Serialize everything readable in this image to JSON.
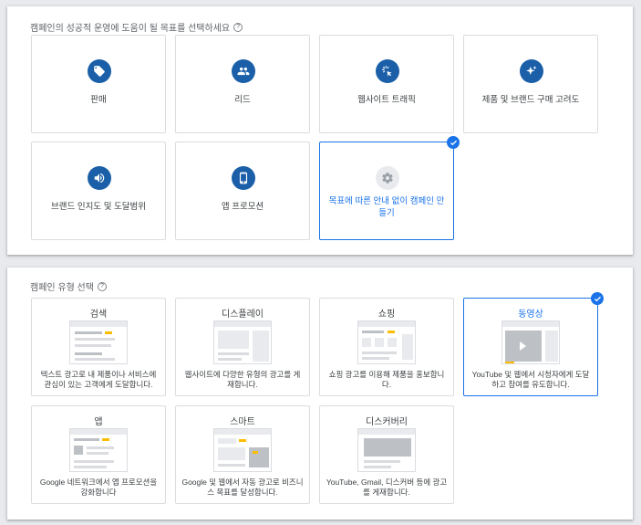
{
  "goal_section": {
    "title": "캠페인의 성공적 운영에 도움이 될 목표를 선택하세요",
    "help_icon": "question-circle-icon",
    "items": [
      {
        "label": "판매",
        "icon": "tag-icon"
      },
      {
        "label": "리드",
        "icon": "people-icon"
      },
      {
        "label": "웹사이트 트래픽",
        "icon": "cursor-click-icon"
      },
      {
        "label": "제품 및 브랜드 구매 고려도",
        "icon": "sparkle-icon"
      },
      {
        "label": "브랜드 인지도 및 도달범위",
        "icon": "speaker-icon"
      },
      {
        "label": "앱 프로모션",
        "icon": "phone-icon"
      },
      {
        "label": "목표에 따른 안내 없이 캠페인 만들기",
        "icon": "gear-icon",
        "selected": true
      }
    ]
  },
  "type_section": {
    "title": "캠페인 유형 선택",
    "help_icon": "question-circle-icon",
    "items": [
      {
        "label": "검색",
        "desc": "텍스트 광고로 내 제품이나 서비스에 관심이 있는 고객에게 도달합니다."
      },
      {
        "label": "디스플레이",
        "desc": "웹사이트에 다양한 유형의 광고를 게재합니다."
      },
      {
        "label": "쇼핑",
        "desc": "쇼핑 광고를 이용해 제품을 홍보합니다."
      },
      {
        "label": "동영상",
        "desc": "YouTube 및 웹에서 시청자에게 도달하고 참여를 유도합니다.",
        "selected": true
      },
      {
        "label": "앱",
        "desc": "Google 네트워크에서 앱 프로모션을 강화합니다"
      },
      {
        "label": "스마트",
        "desc": "Google 및 웹에서 자동 광고로 비즈니스 목표를 달성합니다."
      },
      {
        "label": "디스커버리",
        "desc": "YouTube, Gmail, 디스커버 등에 광고를 게재합니다."
      }
    ]
  },
  "colors": {
    "accent": "#1a73e8",
    "icon_bg": "#1a5fa8",
    "highlight": "#fbbc04"
  }
}
